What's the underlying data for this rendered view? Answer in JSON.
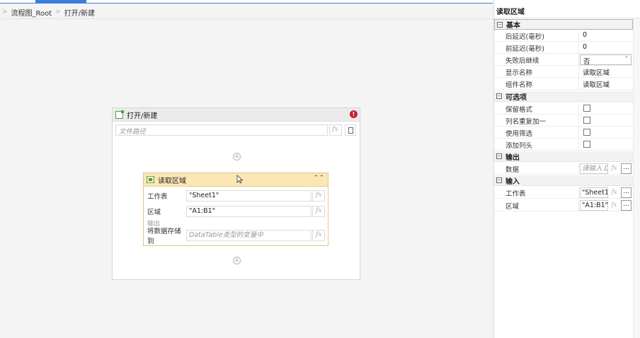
{
  "breadcrumb": {
    "items": [
      "流程图_Root",
      "打开/新建"
    ]
  },
  "outer_card": {
    "title": "打开/新建",
    "path_placeholder": "文件路径",
    "fx_label": "fx"
  },
  "inner_card": {
    "title": "读取区域",
    "fields": [
      {
        "label": "工作表",
        "value": "\"Sheet1\""
      },
      {
        "label": "区域",
        "value": "\"A1:B1\""
      }
    ],
    "output_section_label": "输出",
    "output_field": {
      "label": "将数据存储到",
      "placeholder": "DataTable类型的变量中"
    },
    "fx_label": "fx"
  },
  "panel": {
    "title": "读取区域",
    "sections": {
      "basic": {
        "title": "基本",
        "rows": [
          {
            "name": "后延迟(毫秒)",
            "value": "0"
          },
          {
            "name": "前延迟(毫秒)",
            "value": "0"
          },
          {
            "name": "失败后继续",
            "value": "否"
          },
          {
            "name": "显示名称",
            "value": "读取区域"
          },
          {
            "name": "组件名称",
            "value": "读取区域"
          }
        ]
      },
      "optional": {
        "title": "可选项",
        "rows": [
          {
            "name": "保留格式",
            "checked": false
          },
          {
            "name": "列名重复加一",
            "checked": false
          },
          {
            "name": "使用筛选",
            "checked": false
          },
          {
            "name": "添加列头",
            "checked": false
          }
        ]
      },
      "output": {
        "title": "输出",
        "rows": [
          {
            "name": "数据",
            "placeholder": "请输入 Da"
          }
        ]
      },
      "input": {
        "title": "输入",
        "rows": [
          {
            "name": "工作表",
            "value": "\"Sheet1\""
          },
          {
            "name": "区域",
            "value": "\"A1:B1\""
          }
        ]
      }
    },
    "toggle_symbol": "−",
    "dropdown_arrow": "˅",
    "more_label": "...",
    "fx_label": "fx"
  },
  "colors": {
    "accent": "#3b7dd8",
    "activity_header": "#fbe6b4",
    "error": "#c8202a",
    "success_icon": "#4aa04a"
  },
  "icons": {
    "sequence": "open-workbook-icon",
    "activity": "read-range-icon",
    "error": "error-icon",
    "collapse": "double-chevron-up-icon",
    "add": "plus-circle-icon",
    "file": "file-picker-icon"
  }
}
